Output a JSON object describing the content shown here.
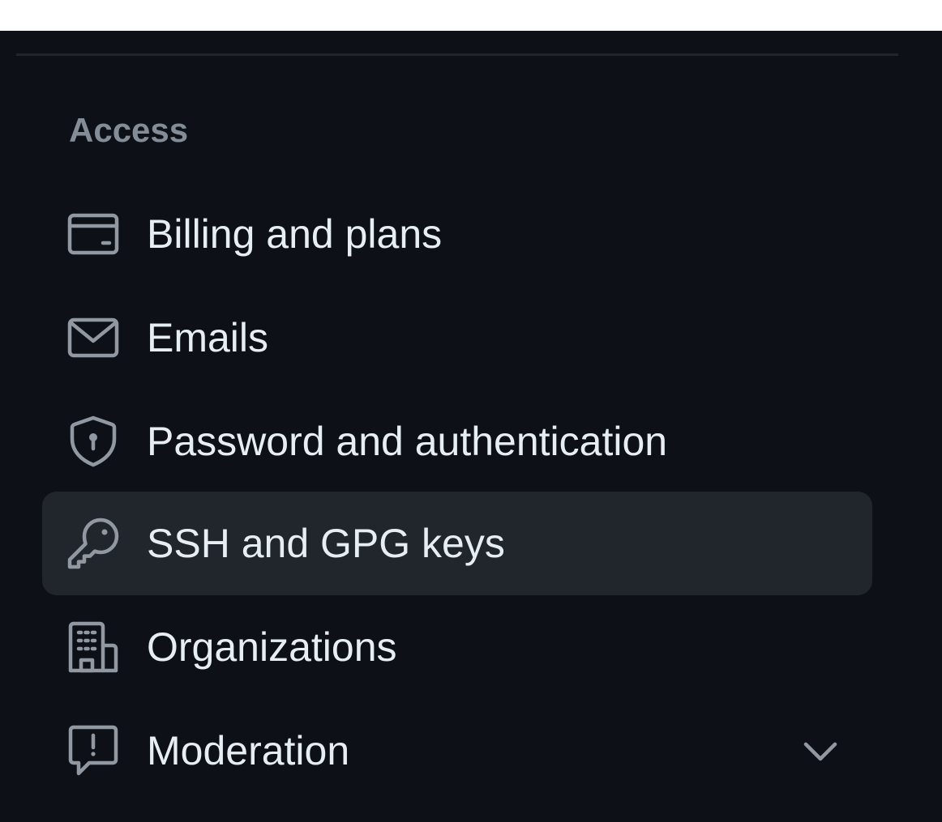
{
  "sidebar": {
    "section_heading": "Access",
    "items": [
      {
        "label": "Billing and plans",
        "icon": "credit-card-icon",
        "selected": false
      },
      {
        "label": "Emails",
        "icon": "mail-icon",
        "selected": false
      },
      {
        "label": "Password and authentication",
        "icon": "shield-lock-icon",
        "selected": false
      },
      {
        "label": "SSH and GPG keys",
        "icon": "key-icon",
        "selected": true
      },
      {
        "label": "Organizations",
        "icon": "organization-icon",
        "selected": false
      },
      {
        "label": "Moderation",
        "icon": "report-icon",
        "selected": false,
        "expandable": true
      }
    ]
  },
  "colors": {
    "background": "#0d1117",
    "selected_background": "#21262d",
    "text_primary": "#e6edf3",
    "text_muted": "#848d97",
    "icon": "#9198a1"
  }
}
